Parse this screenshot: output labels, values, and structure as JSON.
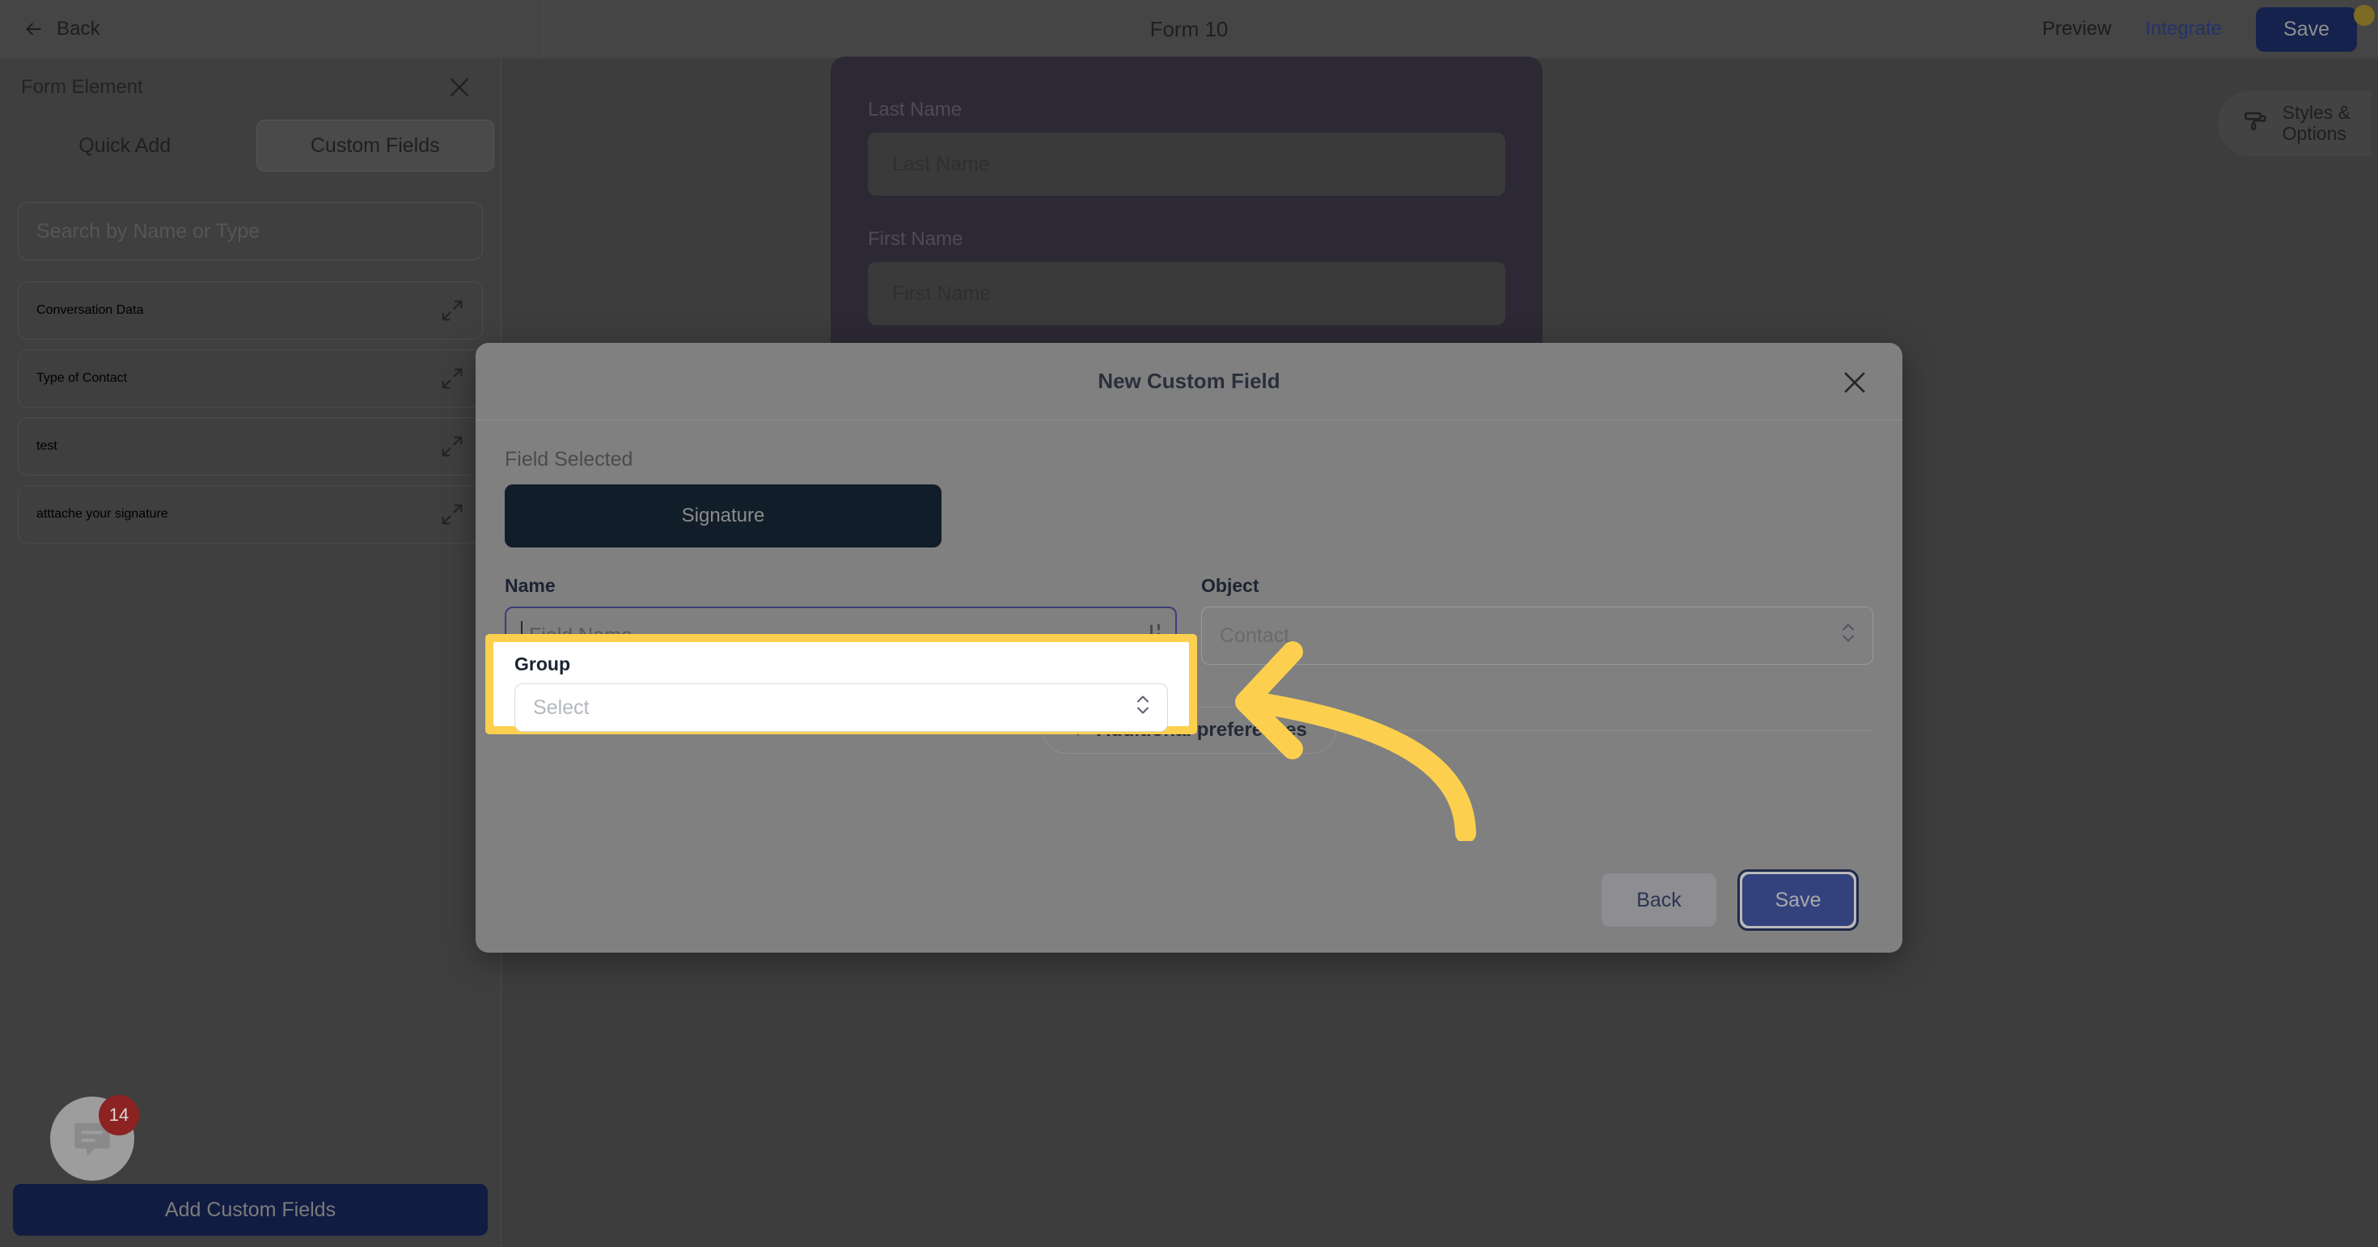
{
  "topbar": {
    "back_label": "Back",
    "title": "Form 10",
    "preview_label": "Preview",
    "integrate_label": "Integrate",
    "save_label": "Save",
    "notification_dot_color": "#7d6a24",
    "save_bg": "#15224d"
  },
  "sidepanel": {
    "title": "Form Element",
    "close_icon": "close-icon",
    "tabs": [
      {
        "label": "Quick Add",
        "active": false
      },
      {
        "label": "Custom Fields",
        "active": true
      }
    ],
    "search_placeholder": "Search by Name or Type",
    "items": [
      {
        "label": "Conversation Data",
        "icon": "expand-icon"
      },
      {
        "label": "Type of Contact",
        "icon": "expand-icon"
      },
      {
        "label": "test",
        "icon": "expand-icon"
      },
      {
        "label": "atttache your signature",
        "icon": "expand-icon"
      }
    ],
    "add_button_label": "Add Custom Fields"
  },
  "chat_widget": {
    "icon": "chat-bubble-icon",
    "badge_count": "14",
    "badge_color": "#8d2222"
  },
  "canvas": {
    "styles_options": {
      "icon": "paint-roller-icon",
      "line1": "Styles &",
      "line2": "Options"
    },
    "form_fields": [
      {
        "label": "Last Name",
        "placeholder": "Last Name"
      },
      {
        "label": "First Name",
        "placeholder": "First Name"
      }
    ]
  },
  "modal": {
    "title": "New Custom Field",
    "close_icon": "close-icon",
    "field_selected_label": "Field Selected",
    "selected_field": "Signature",
    "name": {
      "label": "Name",
      "placeholder": "Field Name",
      "value": "",
      "focused": true,
      "trailing_icon": "resize-grip-icon"
    },
    "object": {
      "label": "Object",
      "value": "Contact",
      "icon": "chevron-up-down-icon"
    },
    "group": {
      "label": "Group",
      "placeholder": "Select",
      "value": "",
      "icon": "chevron-up-down-icon",
      "highlight_color": "#fcd04e"
    },
    "additional_preferences": {
      "label": "Additional preferences",
      "icon": "plus-icon"
    },
    "footer": {
      "back_label": "Back",
      "save_label": "Save",
      "save_bg": "#33427d"
    }
  },
  "annotation": {
    "arrow_color": "#fcd04e",
    "arrow_direction": "left",
    "points_to": "group-field"
  }
}
